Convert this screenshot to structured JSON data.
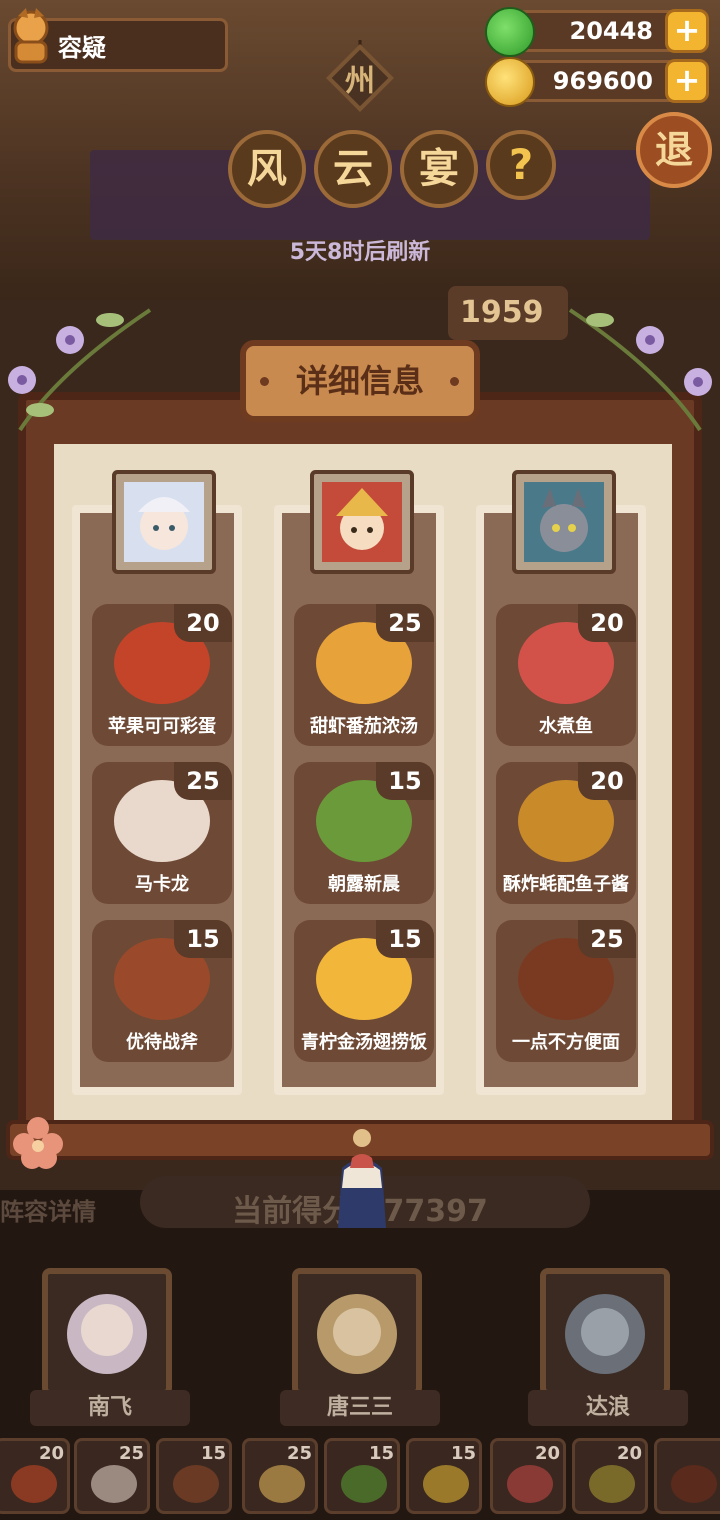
{
  "player": {
    "name": "容疑"
  },
  "currencies": [
    {
      "value": "20448",
      "icon": "green-gem-icon"
    },
    {
      "value": "969600",
      "icon": "coin-icon"
    }
  ],
  "province_tag": "州",
  "event_title": [
    "风",
    "云",
    "宴"
  ],
  "help_label": "?",
  "exit_label": "退",
  "refresh_notice": "5天8时后刷新",
  "background": {
    "score_partial": "1959",
    "score_text": "当前得分 177397",
    "lineup_label": "阵容详情"
  },
  "modal": {
    "title": "详细信息"
  },
  "columns": [
    {
      "dishes": [
        {
          "name": "苹果可可彩蛋",
          "score": "20",
          "color": "#c4442a"
        },
        {
          "name": "马卡龙",
          "score": "25",
          "color": "#e9d8cc"
        },
        {
          "name": "优待战斧",
          "score": "15",
          "color": "#9a4a2a"
        }
      ]
    },
    {
      "dishes": [
        {
          "name": "甜虾番茄浓汤",
          "score": "25",
          "color": "#e8a23a"
        },
        {
          "name": "朝露新晨",
          "score": "15",
          "color": "#6a9a3a"
        },
        {
          "name": "青柠金汤翅捞饭",
          "score": "15",
          "color": "#f2b63a"
        }
      ]
    },
    {
      "dishes": [
        {
          "name": "水煮鱼",
          "score": "20",
          "color": "#d2524a"
        },
        {
          "name": "酥炸蚝配鱼子酱",
          "score": "20",
          "color": "#c98a2a"
        },
        {
          "name": "一点不方便面",
          "score": "25",
          "color": "#7a3a22"
        }
      ]
    }
  ],
  "lineup": [
    {
      "name": "南飞"
    },
    {
      "name": "唐三三"
    },
    {
      "name": "达浪"
    }
  ],
  "mini_dishes": [
    "20",
    "25",
    "15",
    "25",
    "15",
    "15",
    "20",
    "20"
  ]
}
